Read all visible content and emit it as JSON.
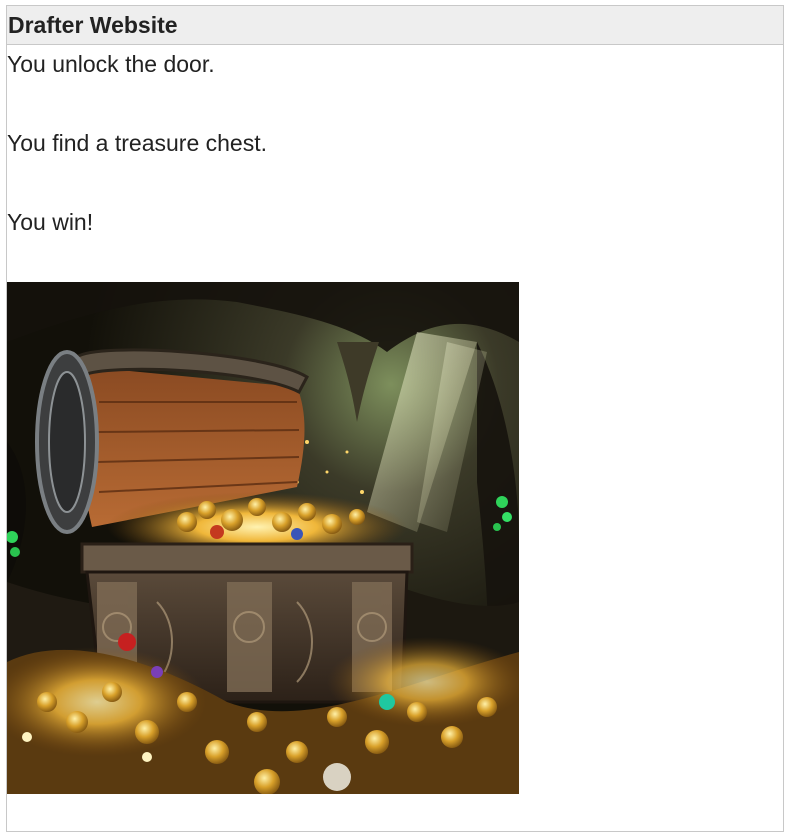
{
  "header": {
    "title": "Drafter Website"
  },
  "main": {
    "paragraphs": [
      "You unlock the door.",
      "You find a treasure chest.",
      "You win!"
    ],
    "image": {
      "subject": "treasure-chest-in-cave-image"
    }
  },
  "colors": {
    "header_bg": "#eeeeee",
    "border": "#c8c8c8",
    "text": "#222222",
    "gold": "#e0a526",
    "cave": "#1d1a14"
  }
}
